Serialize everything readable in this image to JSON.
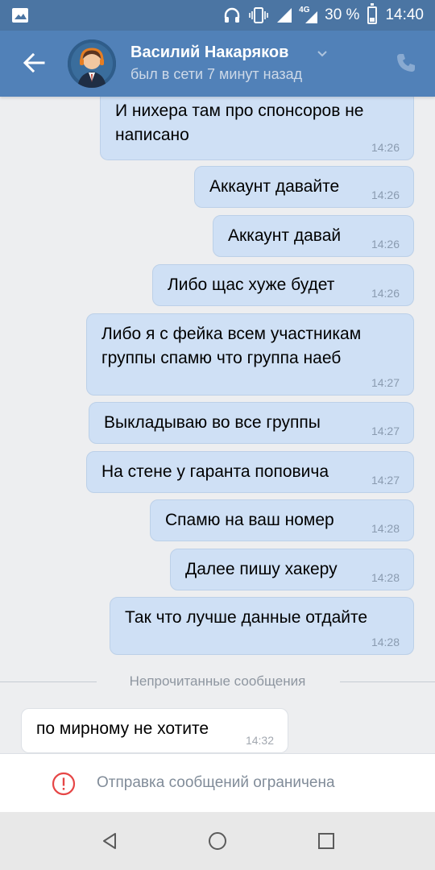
{
  "status_bar": {
    "network_label": "4G",
    "battery": "30 %",
    "battery_level": 0.3,
    "time": "14:40",
    "icons": [
      "gallery-icon",
      "headphones-icon",
      "vibrate-icon",
      "signal-icon",
      "signal-4g-icon",
      "battery-icon"
    ]
  },
  "header": {
    "name": "Василий Накаряков",
    "status": "был в сети 7 минут назад",
    "icons": [
      "back-arrow-icon",
      "avatar",
      "chevron-down-icon",
      "phone-icon"
    ]
  },
  "messages": [
    {
      "text_lines": [
        "И нихера там про спонсоров не",
        "написано"
      ],
      "time": "14:26",
      "direction": "outgoing"
    },
    {
      "text_lines": [
        "Аккаунт давайте"
      ],
      "time": "14:26",
      "direction": "outgoing"
    },
    {
      "text_lines": [
        "Аккаунт давай"
      ],
      "time": "14:26",
      "direction": "outgoing"
    },
    {
      "text_lines": [
        "Либо щас хуже будет"
      ],
      "time": "14:26",
      "direction": "outgoing"
    },
    {
      "text_lines": [
        "Либо я с фейка всем участникам",
        "группы спамю что группа наеб"
      ],
      "time": "14:27",
      "direction": "outgoing"
    },
    {
      "text_lines": [
        "Выкладываю во все группы"
      ],
      "time": "14:27",
      "direction": "outgoing"
    },
    {
      "text_lines": [
        "На стене у гаранта поповича"
      ],
      "time": "14:27",
      "direction": "outgoing"
    },
    {
      "text_lines": [
        "Спамю на ваш номер"
      ],
      "time": "14:28",
      "direction": "outgoing"
    },
    {
      "text_lines": [
        "Далее пишу хакеру"
      ],
      "time": "14:28",
      "direction": "outgoing"
    },
    {
      "text_lines": [
        "Так что лучше данные отдайте"
      ],
      "time": "14:28",
      "direction": "outgoing"
    },
    {
      "text_lines": [
        "по мирному не хотите"
      ],
      "time": "14:32",
      "direction": "incoming"
    }
  ],
  "unread_divider": "Непрочитанные сообщения",
  "restriction": {
    "text": "Отправка сообщений ограничена",
    "icon": "warning-icon",
    "icon_color": "#e64646"
  },
  "colors": {
    "header_bg": "#5181b8",
    "status_bar_bg": "#4b75a3",
    "outgoing_bubble": "#cfe0f5",
    "incoming_bubble": "#ffffff",
    "chat_bg": "#edeef0"
  },
  "nav_bar": {
    "icons": [
      "back-triangle-icon",
      "home-circle-icon",
      "recents-square-icon"
    ]
  }
}
